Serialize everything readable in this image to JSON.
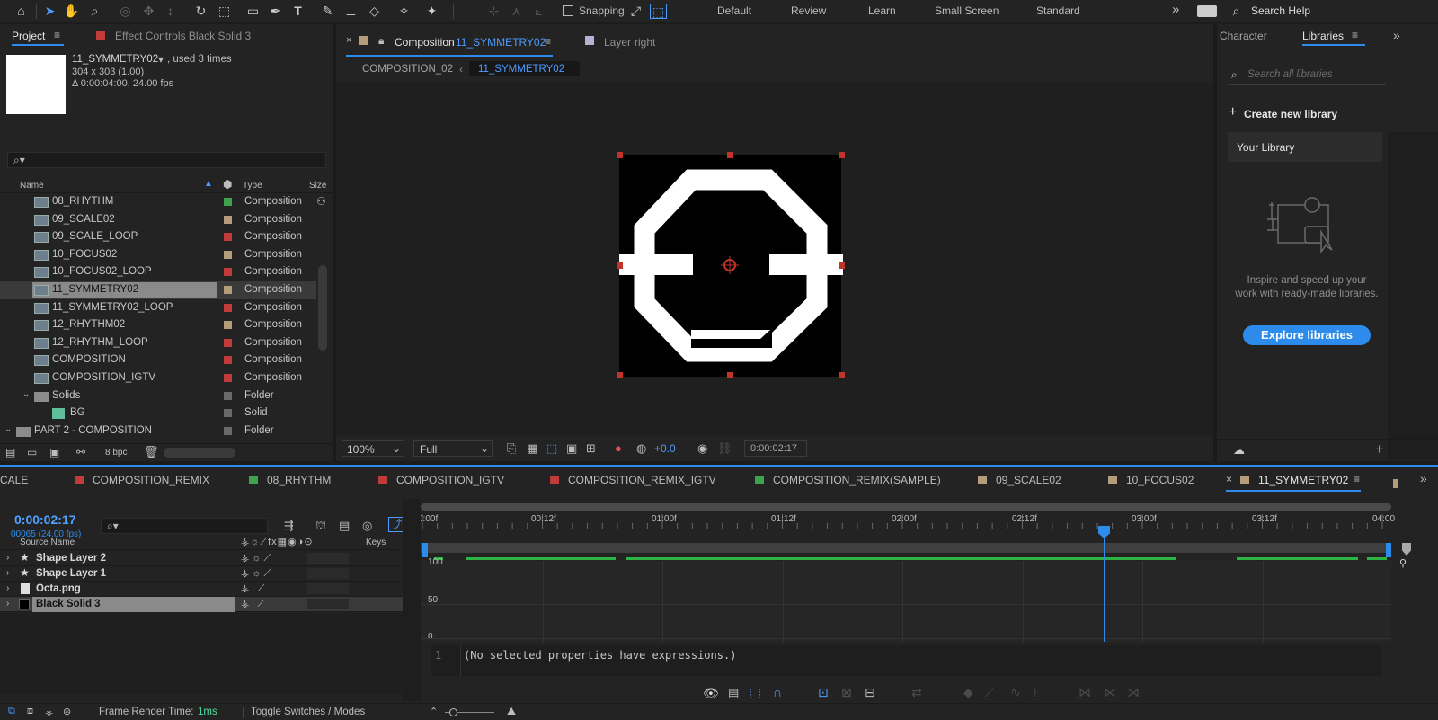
{
  "toolbar": {
    "snapping_label": "Snapping",
    "workspaces": [
      "Default",
      "Review",
      "Learn",
      "Small Screen",
      "Standard"
    ],
    "more": "»",
    "search_placeholder": "Search Help"
  },
  "project_panel": {
    "tab_project": "Project",
    "tab_effect_controls": "Effect Controls Black Solid 3",
    "preview_name": "11_SYMMETRY02",
    "preview_used": ", used 3 times",
    "preview_dims": "304 x 303 (1.00)",
    "preview_duration": "Δ 0:00:04:00, 24.00 fps",
    "col_name": "Name",
    "col_type": "Type",
    "col_size": "Size",
    "items": [
      {
        "name": "08_RHYTHM",
        "type": "Composition",
        "label_color": "#3fa34d"
      },
      {
        "name": "09_SCALE02",
        "type": "Composition",
        "label_color": "#b59c7a"
      },
      {
        "name": "09_SCALE_LOOP",
        "type": "Composition",
        "label_color": "#c23b3b"
      },
      {
        "name": "10_FOCUS02",
        "type": "Composition",
        "label_color": "#b59c7a"
      },
      {
        "name": "10_FOCUS02_LOOP",
        "type": "Composition",
        "label_color": "#c23b3b"
      },
      {
        "name": "11_SYMMETRY02",
        "type": "Composition",
        "label_color": "#b59c7a"
      },
      {
        "name": "11_SYMMETRY02_LOOP",
        "type": "Composition",
        "label_color": "#c23b3b"
      },
      {
        "name": "12_RHYTHM02",
        "type": "Composition",
        "label_color": "#b59c7a"
      },
      {
        "name": "12_RHYTHM_LOOP",
        "type": "Composition",
        "label_color": "#c23b3b"
      },
      {
        "name": "COMPOSITION",
        "type": "Composition",
        "label_color": "#c23b3b"
      },
      {
        "name": "COMPOSITION_IGTV",
        "type": "Composition",
        "label_color": "#c23b3b"
      },
      {
        "name": "Solids",
        "type": "Folder",
        "label_color": "#6a6a6a"
      },
      {
        "name": "BG",
        "type": "Solid",
        "label_color": "#6a6a6a"
      },
      {
        "name": "PART 2 - COMPOSITION",
        "type": "Folder",
        "label_color": "#6a6a6a"
      }
    ],
    "bpc": "8 bpc"
  },
  "comp_viewer": {
    "tab_label_prefix": "Composition",
    "tab_label_name": "11_SYMMETRY02",
    "layer_tab_prefix": "Layer",
    "layer_tab_name": "right",
    "breadcrumb_parent": "COMPOSITION_02",
    "breadcrumb_current": "11_SYMMETRY02",
    "zoom": "100%",
    "resolution": "Full",
    "exposure": "+0.0",
    "timecode": "0:00:02:17"
  },
  "libraries": {
    "tab_character": "Character",
    "tab_libraries": "Libraries",
    "search_placeholder": "Search all libraries",
    "create_label": "Create new library",
    "your_library": "Your Library",
    "promo_text": "Inspire and speed up your work with ready-made libraries.",
    "explore_button": "Explore libraries"
  },
  "timeline": {
    "tabs": [
      {
        "name": "CALE",
        "color": ""
      },
      {
        "name": "COMPOSITION_REMIX",
        "color": "#c23b3b"
      },
      {
        "name": "08_RHYTHM",
        "color": "#3fa34d"
      },
      {
        "name": "COMPOSITION_IGTV",
        "color": "#c23b3b"
      },
      {
        "name": "COMPOSITION_REMIX_IGTV",
        "color": "#c23b3b"
      },
      {
        "name": "COMPOSITION_REMIX(SAMPLE)",
        "color": "#3fa34d"
      },
      {
        "name": "09_SCALE02",
        "color": "#b59c7a"
      },
      {
        "name": "10_FOCUS02",
        "color": "#b59c7a"
      },
      {
        "name": "11_SYMMETRY02",
        "color": "#b59c7a"
      }
    ],
    "current_time": "0:00:02:17",
    "frame_info": "00065 (24.00 fps)",
    "col_source_name": "Source Name",
    "col_keys": "Keys",
    "layers": [
      {
        "name": "Shape Layer 2",
        "icon": "star-icon"
      },
      {
        "name": "Shape Layer 1",
        "icon": "star-icon"
      },
      {
        "name": "Octa.png",
        "icon": "file-icon"
      },
      {
        "name": "Black Solid 3",
        "icon": "solid-icon"
      }
    ],
    "ruler_labels": [
      "0:00f",
      "00:12f",
      "01:00f",
      "01:12f",
      "02:00f",
      "02:12f",
      "03:00f",
      "03:12f",
      "04:00"
    ],
    "playhead_fraction": 0.677,
    "graph_labels": [
      "100",
      "50",
      "0"
    ],
    "expression_line": "1",
    "expression_text": "(No selected properties have expressions.)",
    "frame_render_label": "Frame Render Time:",
    "frame_render_value": "1ms",
    "toggle_label": "Toggle Switches / Modes"
  },
  "colors": {
    "accent": "#2d8ceb",
    "timecode": "#4fa3ff",
    "green_bar": "#2fb344",
    "handle": "#c0342b"
  }
}
